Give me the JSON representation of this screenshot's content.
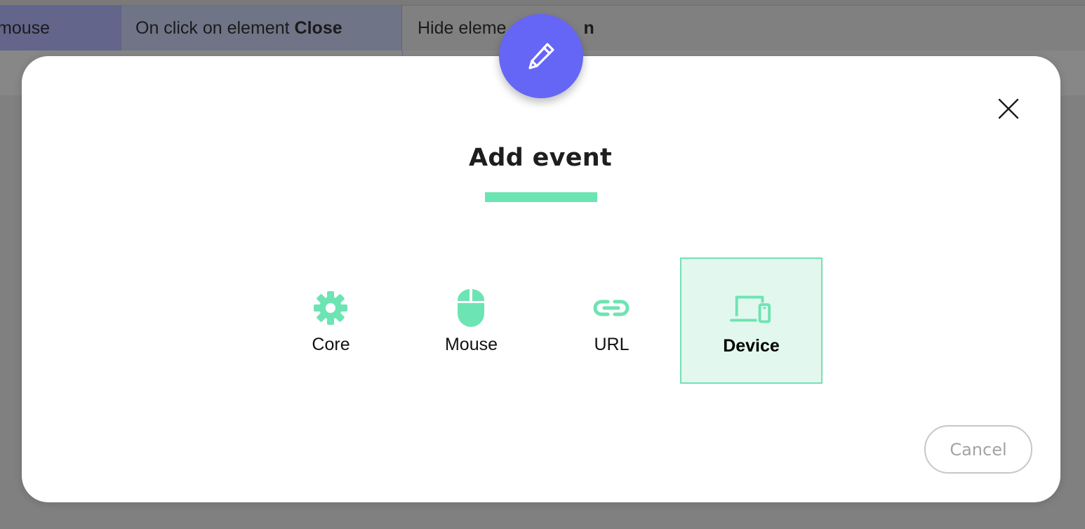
{
  "background": {
    "row1": {
      "cell1": "mouse",
      "cell2_prefix": "On click on element",
      "cell2_bold": "Close",
      "cell3_prefix": "Hide eleme",
      "cell3_bold": "n"
    }
  },
  "modal": {
    "title": "Add event",
    "header_icon": "pencil-icon",
    "close_icon": "close-icon",
    "options": [
      {
        "label": "Core",
        "icon": "gear-icon",
        "selected": false
      },
      {
        "label": "Mouse",
        "icon": "mouse-icon",
        "selected": false
      },
      {
        "label": "URL",
        "icon": "link-icon",
        "selected": false
      },
      {
        "label": "Device",
        "icon": "devices-icon",
        "selected": true
      }
    ],
    "cancel_label": "Cancel"
  },
  "colors": {
    "accent_purple": "#6566f5",
    "accent_green": "#6de4b3",
    "selected_bg": "#e2f8ef"
  }
}
